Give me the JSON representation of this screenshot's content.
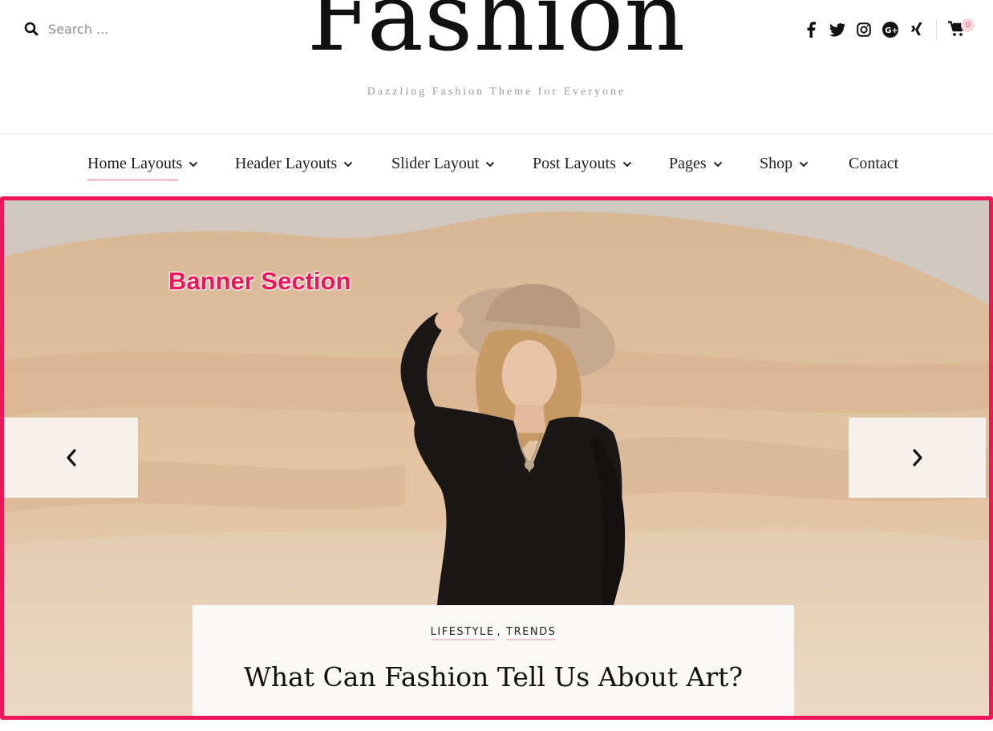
{
  "search": {
    "placeholder": "Search ..."
  },
  "site": {
    "title": "Fashion",
    "tagline": "Dazzling Fashion Theme for Everyone"
  },
  "social": {
    "icons": [
      "facebook-icon",
      "twitter-icon",
      "instagram-icon",
      "google-plus-icon",
      "xing-icon"
    ]
  },
  "cart": {
    "count": "0"
  },
  "nav": {
    "items": [
      {
        "label": "Home Layouts",
        "has_dropdown": true,
        "active": true
      },
      {
        "label": "Header Layouts",
        "has_dropdown": true
      },
      {
        "label": "Slider Layout",
        "has_dropdown": true
      },
      {
        "label": "Post Layouts",
        "has_dropdown": true
      },
      {
        "label": "Pages",
        "has_dropdown": true
      },
      {
        "label": "Shop",
        "has_dropdown": true
      },
      {
        "label": "Contact",
        "has_dropdown": false
      }
    ]
  },
  "banner": {
    "label": "Banner Section",
    "categories": [
      "LIFESTYLE",
      "TRENDS"
    ],
    "category_separator": ",",
    "post_title": "What Can Fashion Tell Us About Art?"
  },
  "colors": {
    "accent": "#ee1559",
    "underline": "#f3c6ce",
    "cart_badge": "#f6d7dc"
  }
}
